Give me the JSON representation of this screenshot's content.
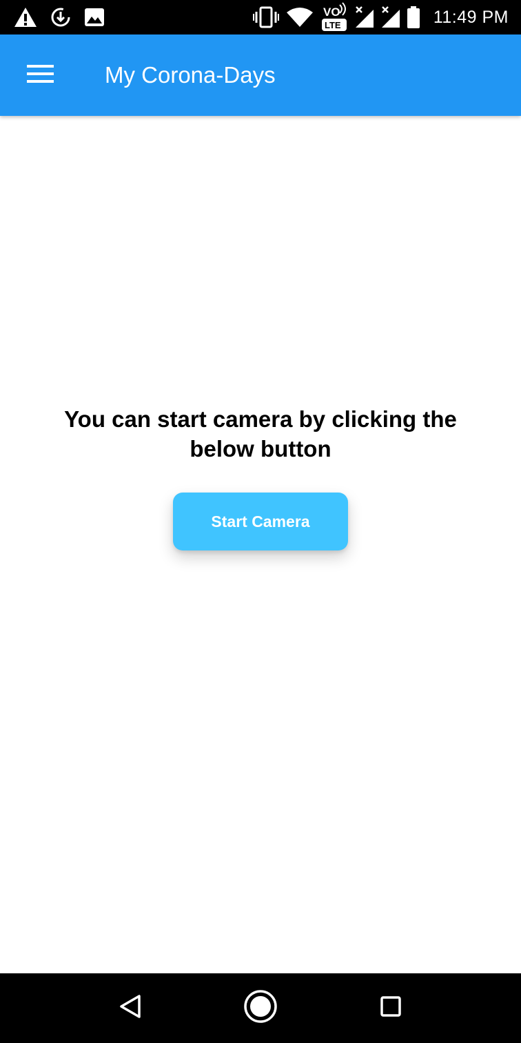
{
  "status_bar": {
    "time": "11:49 PM",
    "left_icons": [
      "warning-icon",
      "sync-download-icon",
      "image-icon"
    ],
    "right_icons": [
      "vibrate-icon",
      "wifi-icon",
      "volte-lte-icon",
      "signal-no-data-icon",
      "signal-no-data-icon",
      "battery-icon"
    ],
    "volte_top": "VO",
    "volte_bottom": "LTE"
  },
  "app_bar": {
    "title": "My Corona-Days",
    "background": "#2196f3",
    "menu_icon": "hamburger-menu-icon"
  },
  "main": {
    "prompt": "You can start camera by clicking the below button",
    "start_button_label": "Start Camera",
    "button_color": "#40c4ff"
  },
  "nav_bar": {
    "buttons": [
      "back-icon",
      "home-icon",
      "recents-icon"
    ]
  }
}
